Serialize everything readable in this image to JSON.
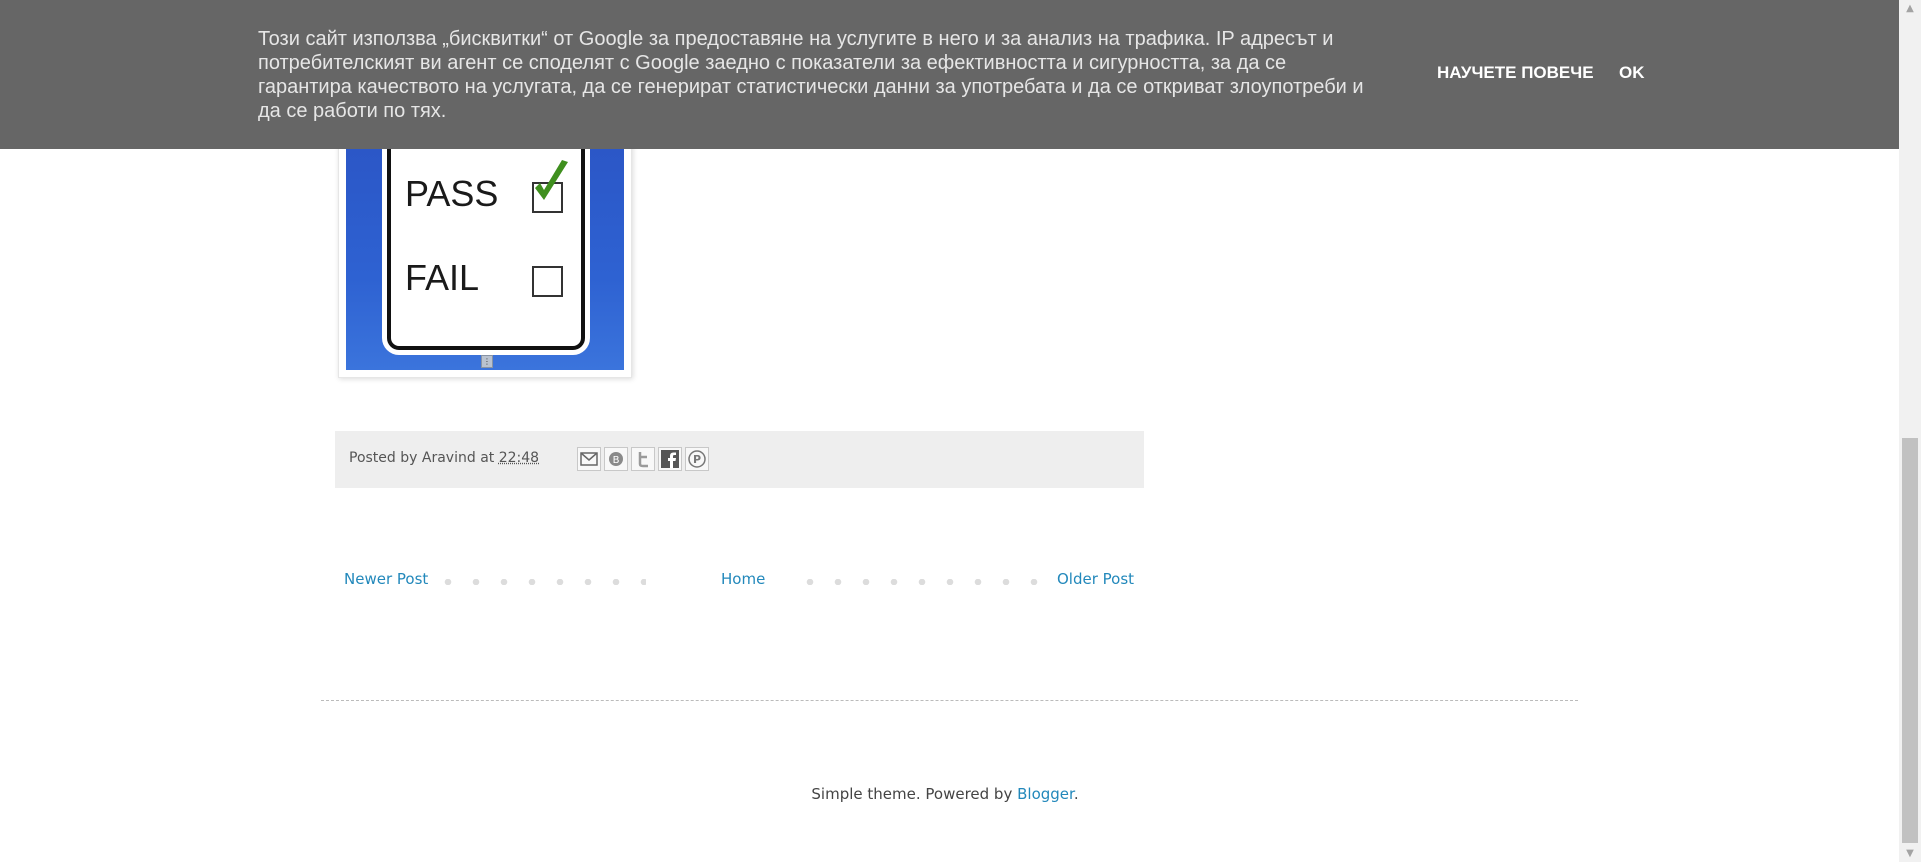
{
  "cookie_notice": {
    "text": "Този сайт използва „бисквитки“ от Google за предоставяне на услугите в него и за анализ на трафика. IP адресът и потребителският ви агент се споделят с Google заедно с показатели за ефективността и сигурността, за да се гарантира качеството на услугата, да се генерират статистически данни за употребата и да се откриват злоупотреби и да се работи по тях.",
    "learn_more_label": "НАУЧЕТЕ ПОВЕЧЕ",
    "ok_label": "OK"
  },
  "post_image": {
    "pass_label": "PASS",
    "fail_label": "FAIL"
  },
  "post_footer": {
    "posted_by_prefix": "Posted by",
    "author": "Aravind",
    "at_label": "at",
    "time": "22:48",
    "share_icons": [
      "email-icon",
      "blogthis-icon",
      "twitter-icon",
      "facebook-icon",
      "pinterest-icon"
    ]
  },
  "pager": {
    "newer_label": "Newer Post",
    "home_label": "Home",
    "older_label": "Older Post"
  },
  "attribution": {
    "prefix": "Simple theme. Powered by",
    "link_label": "Blogger",
    "suffix": "."
  },
  "colors": {
    "link": "#2288bb",
    "cookie_bar_bg": "#666666",
    "footer_bg": "#eeeeee"
  }
}
